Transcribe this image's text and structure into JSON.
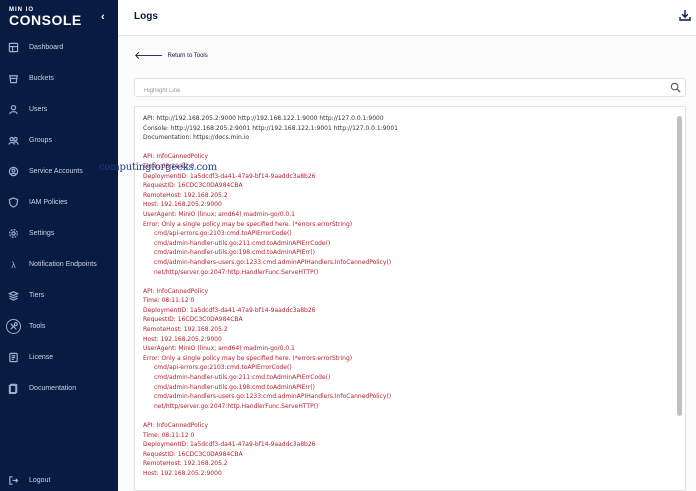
{
  "brand": {
    "top": "MIN IO",
    "main": "CONSOLE"
  },
  "sidebar": {
    "collapse_icon": "chevron-left-icon",
    "items": [
      {
        "label": "Dashboard",
        "icon": "dashboard-icon"
      },
      {
        "label": "Buckets",
        "icon": "bucket-icon"
      },
      {
        "label": "Users",
        "icon": "user-icon"
      },
      {
        "label": "Groups",
        "icon": "groups-icon"
      },
      {
        "label": "Service Accounts",
        "icon": "service-accounts-icon"
      },
      {
        "label": "IAM Policies",
        "icon": "shield-icon"
      },
      {
        "label": "Settings",
        "icon": "gear-icon"
      },
      {
        "label": "Notification Endpoints",
        "icon": "lambda-icon"
      },
      {
        "label": "Tiers",
        "icon": "tiers-icon"
      },
      {
        "label": "Tools",
        "icon": "tools-icon",
        "active": true
      },
      {
        "label": "License",
        "icon": "license-icon"
      },
      {
        "label": "Documentation",
        "icon": "documentation-icon"
      }
    ],
    "logout": {
      "label": "Logout",
      "icon": "logout-icon"
    }
  },
  "header": {
    "title": "Logs",
    "download_icon": "download-icon"
  },
  "back": {
    "label": "Return to Tools",
    "icon": "arrow-left-icon"
  },
  "search": {
    "placeholder": "Highlight Line",
    "value": "",
    "icon": "search-icon"
  },
  "watermark": "computingforgeeks.com",
  "colors": {
    "sidebar_bg": "#081c42",
    "error_text": "#b5202d",
    "info_text": "#333333"
  },
  "log_lines": [
    {
      "text": "API: http://192.168.205.2:9000 http://192.168.122.1:9000 http://127.0.0.1:9000",
      "kind": "info"
    },
    {
      "text": "Console: http://192.168.205.2:9001 http://192.168.122.1:9001 http://127.0.0.1:9001",
      "kind": "info"
    },
    {
      "text": "Documentation: https://docs.min.io",
      "kind": "info"
    },
    {
      "text": "",
      "kind": "blank"
    },
    {
      "text": "API: InfoCannedPolicy",
      "kind": "error"
    },
    {
      "text": "Time: 08:11:12 0",
      "kind": "error"
    },
    {
      "text": "DeploymentID: 1a5dcdf3-da41-47a9-bf14-9aaddc3a8b26",
      "kind": "error"
    },
    {
      "text": "RequestID: 16CDC3C0DA984CBA",
      "kind": "error"
    },
    {
      "text": "RemoteHost: 192.168.205.2",
      "kind": "error"
    },
    {
      "text": "Host: 192.168.205.2:9000",
      "kind": "error"
    },
    {
      "text": "UserAgent: MinIO (linux; amd64) madmin-go/0.0.1",
      "kind": "error"
    },
    {
      "text": "Error: Only a single policy may be specified here. (*errors.errorString)",
      "kind": "error"
    },
    {
      "text": "cmd/api-errors.go:2103:cmd.toAPIErrorCode()",
      "kind": "indent"
    },
    {
      "text": "cmd/admin-handler-utils.go:211:cmd.toAdminAPIErrCode()",
      "kind": "indent"
    },
    {
      "text": "cmd/admin-handler-utils.go:198:cmd.toAdminAPIErr()",
      "kind": "indent"
    },
    {
      "text": "cmd/admin-handlers-users.go:1233:cmd.adminAPIHandlers.InfoCannedPolicy()",
      "kind": "indent"
    },
    {
      "text": "net/http/server.go:2047:http.HandlerFunc.ServeHTTP()",
      "kind": "indent"
    },
    {
      "text": "",
      "kind": "blank"
    },
    {
      "text": "API: InfoCannedPolicy",
      "kind": "error"
    },
    {
      "text": "Time: 08:11:12 0",
      "kind": "error"
    },
    {
      "text": "DeploymentID: 1a5dcdf3-da41-47a9-bf14-9aaddc3a8b26",
      "kind": "error"
    },
    {
      "text": "RequestID: 16CDC3C0DA984CBA",
      "kind": "error"
    },
    {
      "text": "RemoteHost: 192.168.205.2",
      "kind": "error"
    },
    {
      "text": "Host: 192.168.205.2:9000",
      "kind": "error"
    },
    {
      "text": "UserAgent: MinIO (linux; amd64) madmin-go/0.0.1",
      "kind": "error"
    },
    {
      "text": "Error: Only a single policy may be specified here. (*errors.errorString)",
      "kind": "error"
    },
    {
      "text": "cmd/api-errors.go:2103:cmd.toAPIErrorCode()",
      "kind": "indent"
    },
    {
      "text": "cmd/admin-handler-utils.go:211:cmd.toAdminAPIErrCode()",
      "kind": "indent"
    },
    {
      "text": "cmd/admin-handler-utils.go:198:cmd.toAdminAPIErr()",
      "kind": "indent"
    },
    {
      "text": "cmd/admin-handlers-users.go:1233:cmd.adminAPIHandlers.InfoCannedPolicy()",
      "kind": "indent"
    },
    {
      "text": "net/http/server.go:2047:http.HandlerFunc.ServeHTTP()",
      "kind": "indent"
    },
    {
      "text": "",
      "kind": "blank"
    },
    {
      "text": "API: InfoCannedPolicy",
      "kind": "error"
    },
    {
      "text": "Time: 08:11:12 0",
      "kind": "error"
    },
    {
      "text": "DeploymentID: 1a5dcdf3-da41-47a9-bf14-9aaddc3a8b26",
      "kind": "error"
    },
    {
      "text": "RequestID: 16CDC3C0DA984CBA",
      "kind": "error"
    },
    {
      "text": "RemoteHost: 192.168.205.2",
      "kind": "error"
    },
    {
      "text": "Host: 192.168.205.2:9000",
      "kind": "error"
    }
  ]
}
